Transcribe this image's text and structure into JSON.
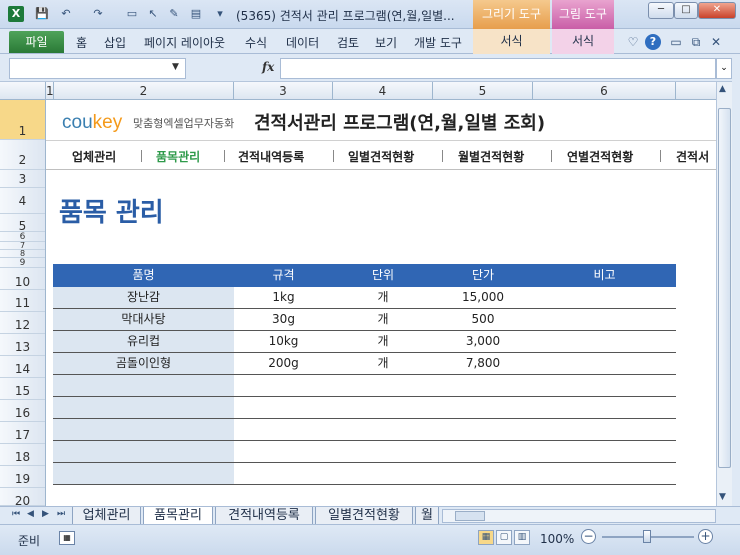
{
  "window": {
    "title": "(5365) 견적서 관리 프로그램(연,월,일별...",
    "context_tab_drawing": "그리기 도구",
    "context_tab_picture": "그림 도구",
    "btn_min": "─",
    "btn_max": "□",
    "btn_close": "✕"
  },
  "quick_access": {
    "app_icon": "X",
    "save": "💾",
    "undo": "↶",
    "redo": "↷",
    "more": "▾"
  },
  "ribbon": {
    "file": "파일",
    "tabs": [
      "홈",
      "삽입",
      "페이지 레이아웃",
      "수식",
      "데이터",
      "검토",
      "보기",
      "개발 도구"
    ],
    "context_sub_drawing": "서식",
    "context_sub_picture": "서식",
    "help": "?",
    "chevron": "♡"
  },
  "formula_bar": {
    "name_box": "",
    "fx": "fx",
    "formula": ""
  },
  "columns": [
    "1",
    "2",
    "3",
    "4",
    "5",
    "6"
  ],
  "rows": [
    "1",
    "2",
    "3",
    "4",
    "5",
    "6",
    "7",
    "8",
    "9",
    "10",
    "11",
    "12",
    "13",
    "14",
    "15",
    "16",
    "17",
    "18",
    "19",
    "20"
  ],
  "sheet": {
    "logo": "cou",
    "logo_key": "key",
    "logo_sub": "맞춤형엑셀업무자동화",
    "title": "견적서관리 프로그램(연,월,일별 조회)",
    "nav": [
      "업체관리",
      "품목관리",
      "견적내역등록",
      "일별견적현황",
      "월별견적현황",
      "연별견적현황",
      "견적서"
    ],
    "active_nav_color": "#2e9a4a",
    "heading": "품목 관리",
    "table": {
      "headers": [
        "품명",
        "규격",
        "단위",
        "단가",
        "비고"
      ],
      "rows": [
        [
          "장난감",
          "1kg",
          "개",
          "15,000",
          ""
        ],
        [
          "막대사탕",
          "30g",
          "개",
          "500",
          ""
        ],
        [
          "유리컵",
          "10kg",
          "개",
          "3,000",
          ""
        ],
        [
          "곰돌이인형",
          "200g",
          "개",
          "7,800",
          ""
        ],
        [
          "",
          "",
          "",
          "",
          ""
        ],
        [
          "",
          "",
          "",
          "",
          ""
        ],
        [
          "",
          "",
          "",
          "",
          ""
        ],
        [
          "",
          "",
          "",
          "",
          ""
        ],
        [
          "",
          "",
          "",
          "",
          ""
        ]
      ]
    }
  },
  "sheet_tabs": [
    "업체관리",
    "품목관리",
    "견적내역등록",
    "일별견적현황",
    "월"
  ],
  "active_sheet": "품목관리",
  "status": {
    "ready": "준비",
    "zoom": "100%"
  },
  "colors": {
    "header_blue": "#3066b4",
    "heading_blue": "#2a5da6",
    "excel_green": "#2a7a36"
  }
}
